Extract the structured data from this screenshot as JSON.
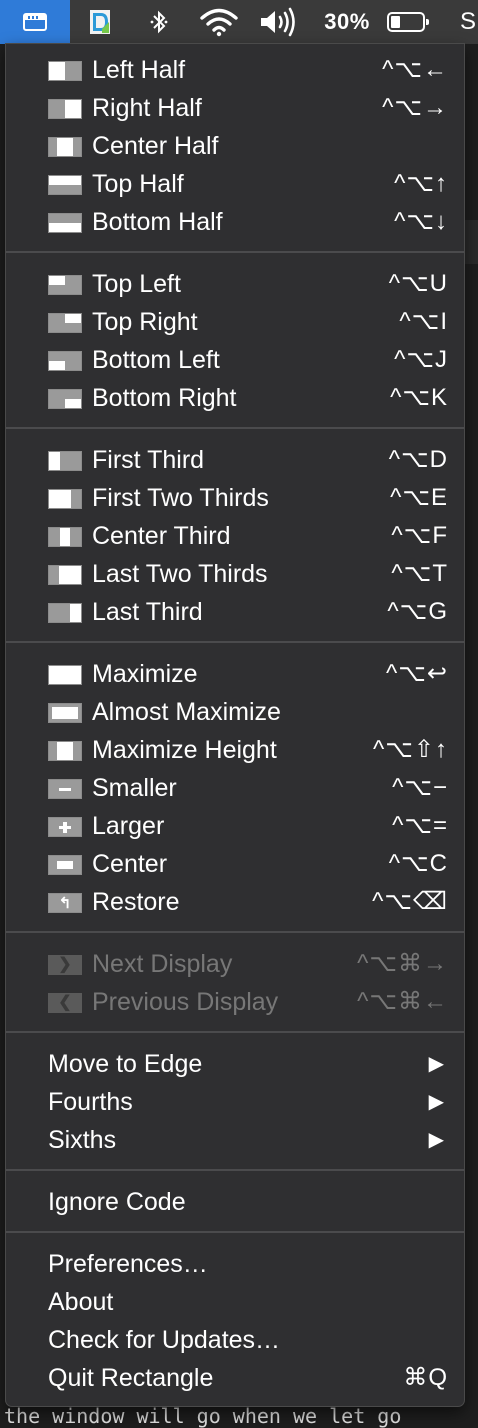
{
  "menubar": {
    "app_icon": "rectangle-window-icon",
    "battery_percent": "30%",
    "trailing_text": "S"
  },
  "background": {
    "bottom_text": "the window will go when we let go"
  },
  "menu": {
    "groups": [
      [
        {
          "label": "Left Half",
          "shortcut": "^⌥←",
          "icon": "left-half-icon"
        },
        {
          "label": "Right Half",
          "shortcut": "^⌥→",
          "icon": "right-half-icon"
        },
        {
          "label": "Center Half",
          "shortcut": "",
          "icon": "center-half-icon"
        },
        {
          "label": "Top Half",
          "shortcut": "^⌥↑",
          "icon": "top-half-icon"
        },
        {
          "label": "Bottom Half",
          "shortcut": "^⌥↓",
          "icon": "bottom-half-icon"
        }
      ],
      [
        {
          "label": "Top Left",
          "shortcut": "^⌥U",
          "icon": "top-left-icon"
        },
        {
          "label": "Top Right",
          "shortcut": "^⌥I",
          "icon": "top-right-icon"
        },
        {
          "label": "Bottom Left",
          "shortcut": "^⌥J",
          "icon": "bottom-left-icon"
        },
        {
          "label": "Bottom Right",
          "shortcut": "^⌥K",
          "icon": "bottom-right-icon"
        }
      ],
      [
        {
          "label": "First Third",
          "shortcut": "^⌥D",
          "icon": "first-third-icon"
        },
        {
          "label": "First Two Thirds",
          "shortcut": "^⌥E",
          "icon": "first-two-thirds-icon"
        },
        {
          "label": "Center Third",
          "shortcut": "^⌥F",
          "icon": "center-third-icon"
        },
        {
          "label": "Last Two Thirds",
          "shortcut": "^⌥T",
          "icon": "last-two-thirds-icon"
        },
        {
          "label": "Last Third",
          "shortcut": "^⌥G",
          "icon": "last-third-icon"
        }
      ],
      [
        {
          "label": "Maximize",
          "shortcut": "^⌥↩",
          "icon": "maximize-icon"
        },
        {
          "label": "Almost Maximize",
          "shortcut": "",
          "icon": "almost-maximize-icon"
        },
        {
          "label": "Maximize Height",
          "shortcut": "^⌥⇧↑",
          "icon": "maximize-height-icon"
        },
        {
          "label": "Smaller",
          "shortcut": "^⌥−",
          "icon": "smaller-icon"
        },
        {
          "label": "Larger",
          "shortcut": "^⌥=",
          "icon": "larger-icon"
        },
        {
          "label": "Center",
          "shortcut": "^⌥C",
          "icon": "center-icon"
        },
        {
          "label": "Restore",
          "shortcut": "^⌥⌫",
          "icon": "restore-icon"
        }
      ],
      [
        {
          "label": "Next Display",
          "shortcut": "^⌥⌘→",
          "icon": "next-display-icon",
          "disabled": true
        },
        {
          "label": "Previous Display",
          "shortcut": "^⌥⌘←",
          "icon": "previous-display-icon",
          "disabled": true
        }
      ],
      [
        {
          "label": "Move to Edge",
          "submenu": true
        },
        {
          "label": "Fourths",
          "submenu": true
        },
        {
          "label": "Sixths",
          "submenu": true
        }
      ],
      [
        {
          "label": "Ignore Code"
        }
      ],
      [
        {
          "label": "Preferences…"
        },
        {
          "label": "About"
        },
        {
          "label": "Check for Updates…"
        },
        {
          "label": "Quit Rectangle",
          "shortcut": "⌘Q"
        }
      ]
    ]
  },
  "submenu_arrow": "▶"
}
